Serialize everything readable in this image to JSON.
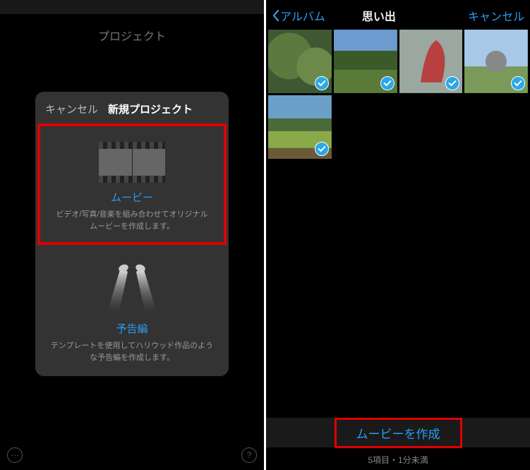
{
  "left": {
    "status": {
      "carrier_placeholder": "",
      "time_placeholder": "",
      "battery_placeholder": ""
    },
    "page_title": "プロジェクト",
    "modal": {
      "cancel": "キャンセル",
      "title": "新規プロジェクト",
      "movie": {
        "title": "ムービー",
        "desc": "ビデオ/写真/音楽を組み合わせてオリジナルムービーを作成します。"
      },
      "trailer": {
        "title": "予告編",
        "desc": "テンプレートを使用してハリウッド作品のような予告編を作成します。"
      }
    },
    "bottom": {
      "ellipsis": "⋯",
      "help": "?"
    }
  },
  "right": {
    "nav": {
      "back": "アルバム",
      "title": "思い出",
      "cancel": "キャンセル"
    },
    "thumbs": [
      {
        "id": 0,
        "selected": true
      },
      {
        "id": 1,
        "selected": true
      },
      {
        "id": 2,
        "selected": true
      },
      {
        "id": 3,
        "selected": true
      },
      {
        "id": 4,
        "selected": true
      }
    ],
    "create_label": "ムービーを作成",
    "footer": "5項目・1分未満"
  }
}
